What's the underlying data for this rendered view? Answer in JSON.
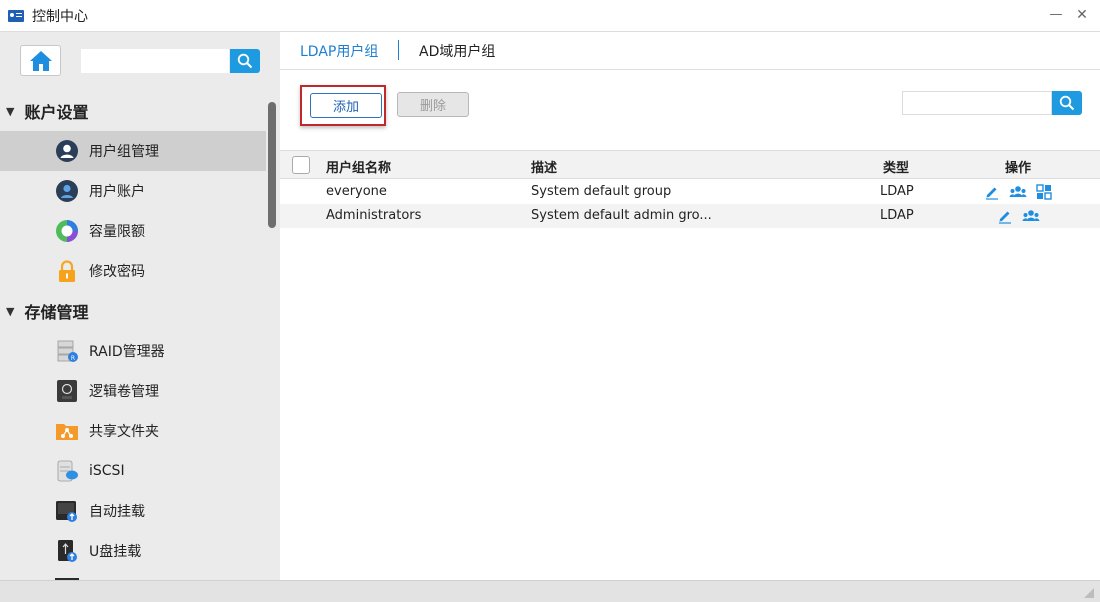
{
  "window": {
    "title": "控制中心",
    "minimize_glyph": "—",
    "close_glyph": "✕"
  },
  "sidebar": {
    "search": {
      "value": "",
      "placeholder": ""
    },
    "sections": [
      {
        "label": "账户设置",
        "items": [
          {
            "label": "用户组管理",
            "icon": "user-group-icon",
            "active": true
          },
          {
            "label": "用户账户",
            "icon": "user-account-icon"
          },
          {
            "label": "容量限额",
            "icon": "quota-icon"
          },
          {
            "label": "修改密码",
            "icon": "lock-icon"
          }
        ]
      },
      {
        "label": "存储管理",
        "items": [
          {
            "label": "RAID管理器",
            "icon": "raid-icon"
          },
          {
            "label": "逻辑卷管理",
            "icon": "lvm-icon"
          },
          {
            "label": "共享文件夹",
            "icon": "shared-folder-icon"
          },
          {
            "label": "iSCSI",
            "icon": "iscsi-icon"
          },
          {
            "label": "自动挂载",
            "icon": "auto-mount-icon"
          },
          {
            "label": "U盘挂载",
            "icon": "usb-mount-icon"
          }
        ]
      }
    ]
  },
  "main": {
    "tabs": [
      {
        "label": "LDAP用户组",
        "active": true
      },
      {
        "label": "AD域用户组",
        "active": false
      }
    ],
    "toolbar": {
      "add_label": "添加",
      "delete_label": "删除",
      "search": {
        "value": "",
        "placeholder": ""
      }
    },
    "table": {
      "columns": [
        "用户组名称",
        "描述",
        "类型",
        "操作"
      ],
      "rows": [
        {
          "name": "everyone",
          "description": "System default group",
          "type": "LDAP",
          "actions": [
            "edit-icon",
            "members-icon",
            "apps-icon"
          ]
        },
        {
          "name": "Administrators",
          "description": "System default admin gro...",
          "type": "LDAP",
          "actions": [
            "edit-icon",
            "members-icon"
          ]
        }
      ]
    }
  },
  "colors": {
    "accent": "#1e9be0",
    "link": "#1e7fd0",
    "highlight_border": "#c0292b",
    "sidebar_bg": "#ebebeb",
    "active_item_bg": "#cfcfcf"
  }
}
